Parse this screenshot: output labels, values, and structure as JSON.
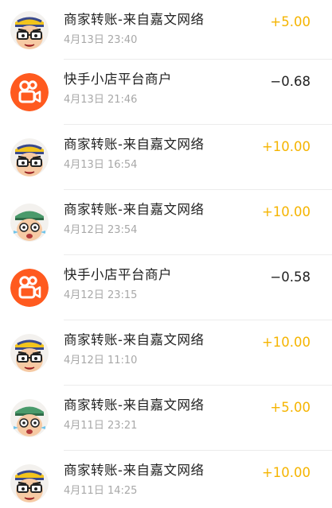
{
  "colors": {
    "income": "#f5b400",
    "expense": "#222222",
    "time": "#a8a8a8",
    "kuaishou": "#ff5a1f"
  },
  "transactions": [
    {
      "avatar": "merchant-avatar-yellow-hat",
      "title": "商家转账-来自嘉文网络",
      "time": "4月13日 23:40",
      "amount": "+5.00",
      "type": "pos"
    },
    {
      "avatar": "kuaishou-logo",
      "title": "快手小店平台商户",
      "time": "4月13日 21:46",
      "amount": "−0.68",
      "type": "neg"
    },
    {
      "avatar": "merchant-avatar-yellow-hat",
      "title": "商家转账-来自嘉文网络",
      "time": "4月13日 16:54",
      "amount": "+10.00",
      "type": "pos"
    },
    {
      "avatar": "merchant-avatar-green-hat",
      "title": "商家转账-来自嘉文网络",
      "time": "4月12日 23:54",
      "amount": "+10.00",
      "type": "pos"
    },
    {
      "avatar": "kuaishou-logo",
      "title": "快手小店平台商户",
      "time": "4月12日 23:15",
      "amount": "−0.58",
      "type": "neg"
    },
    {
      "avatar": "merchant-avatar-yellow-hat",
      "title": "商家转账-来自嘉文网络",
      "time": "4月12日 11:10",
      "amount": "+10.00",
      "type": "pos"
    },
    {
      "avatar": "merchant-avatar-green-hat",
      "title": "商家转账-来自嘉文网络",
      "time": "4月11日 23:21",
      "amount": "+5.00",
      "type": "pos"
    },
    {
      "avatar": "merchant-avatar-yellow-hat",
      "title": "商家转账-来自嘉文网络",
      "time": "4月11日 14:25",
      "amount": "+10.00",
      "type": "pos"
    }
  ]
}
